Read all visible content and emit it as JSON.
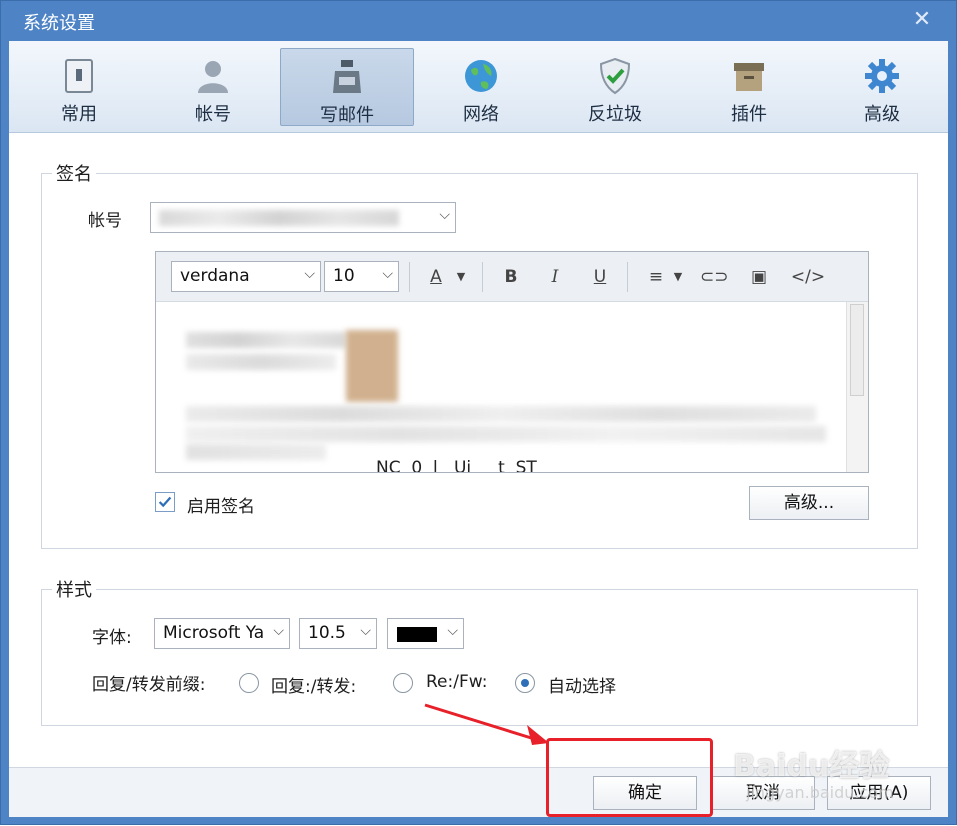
{
  "window": {
    "title": "系统设置"
  },
  "toolbar": {
    "items": [
      {
        "label": "常用",
        "icon": "general-icon"
      },
      {
        "label": "帐号",
        "icon": "account-icon"
      },
      {
        "label": "写邮件",
        "icon": "compose-icon",
        "active": true
      },
      {
        "label": "网络",
        "icon": "globe-icon"
      },
      {
        "label": "反垃圾",
        "icon": "shield-icon"
      },
      {
        "label": "插件",
        "icon": "plugin-box-icon"
      },
      {
        "label": "高级",
        "icon": "gear-icon"
      }
    ]
  },
  "signature": {
    "group_title": "签名",
    "account_label": "帐号",
    "editor": {
      "font": "verdana",
      "size": "10",
      "partial_text": "NC  0  l   Ui     t  ST"
    },
    "enable_label": "启用签名",
    "enable_checked": true,
    "advanced_button": "高级..."
  },
  "style": {
    "group_title": "样式",
    "font_label": "字体:",
    "font_value": "Microsoft Ya",
    "size_value": "10.5",
    "color": "#000000",
    "prefix_label": "回复/转发前缀:",
    "prefix_options": [
      {
        "label": "回复:/转发:",
        "checked": false
      },
      {
        "label": "Re:/Fw:",
        "checked": false
      },
      {
        "label": "自动选择",
        "checked": true
      }
    ]
  },
  "footer": {
    "ok": "确定",
    "cancel": "取消",
    "apply": "应用(A)"
  },
  "annotation_color": "#e8202a",
  "watermark": {
    "main": "Baidu经验",
    "sub": "jingyan.baidu.com"
  }
}
